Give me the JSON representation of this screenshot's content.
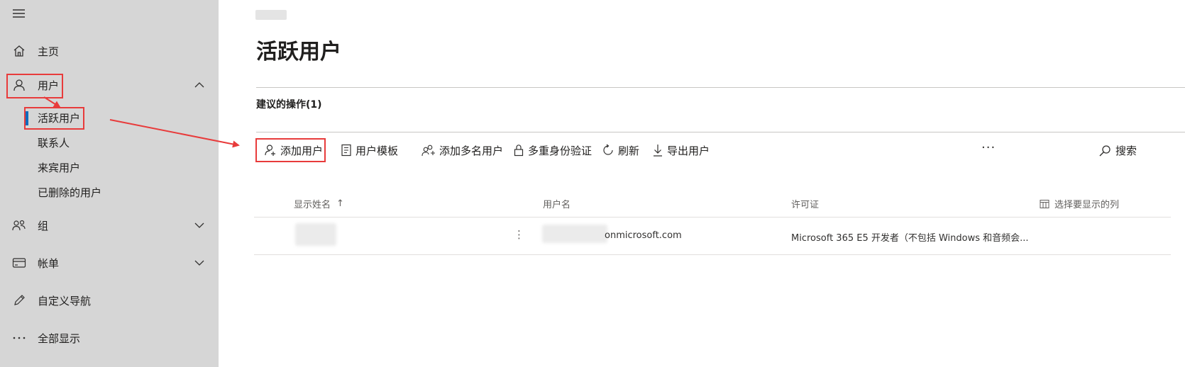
{
  "sidebar": {
    "menu_icon": "hamburger-icon",
    "items": [
      {
        "label": "主页",
        "icon": "home-icon"
      },
      {
        "label": "用户",
        "icon": "person-icon"
      },
      {
        "label": "组",
        "icon": "group-icon"
      },
      {
        "label": "帐单",
        "icon": "credit-card-icon"
      },
      {
        "label": "自定义导航",
        "icon": "pencil-icon"
      },
      {
        "label": "全部显示",
        "icon": "more-horizontal-icon"
      }
    ],
    "users_subitems": [
      {
        "label": "活跃用户",
        "active": true
      },
      {
        "label": "联系人"
      },
      {
        "label": "来宾用户"
      },
      {
        "label": "已删除的用户"
      }
    ]
  },
  "main": {
    "title": "活跃用户",
    "recommended_actions": "建议的操作(1)",
    "toolbar": {
      "add_user": "添加用户",
      "user_templates": "用户模板",
      "add_multiple_users": "添加多名用户",
      "mfa": "多重身份验证",
      "refresh": "刷新",
      "export_users": "导出用户",
      "more": "···",
      "search": "搜索"
    },
    "table": {
      "columns": {
        "display_name": "显示姓名",
        "sort_indicator": "↑",
        "username": "用户名",
        "license": "许可证",
        "choose_columns": "选择要显示的列"
      },
      "rows": [
        {
          "display_name": "",
          "row_menu": "⋮",
          "username": "onmicrosoft.com",
          "license": "Microsoft 365 E5 开发者（不包括 Windows 和音频会..."
        }
      ]
    }
  },
  "colors": {
    "sidebar_bg": "#d6d6d6",
    "highlight_red": "#e83b3b",
    "active_blue": "#0f6cbd"
  }
}
